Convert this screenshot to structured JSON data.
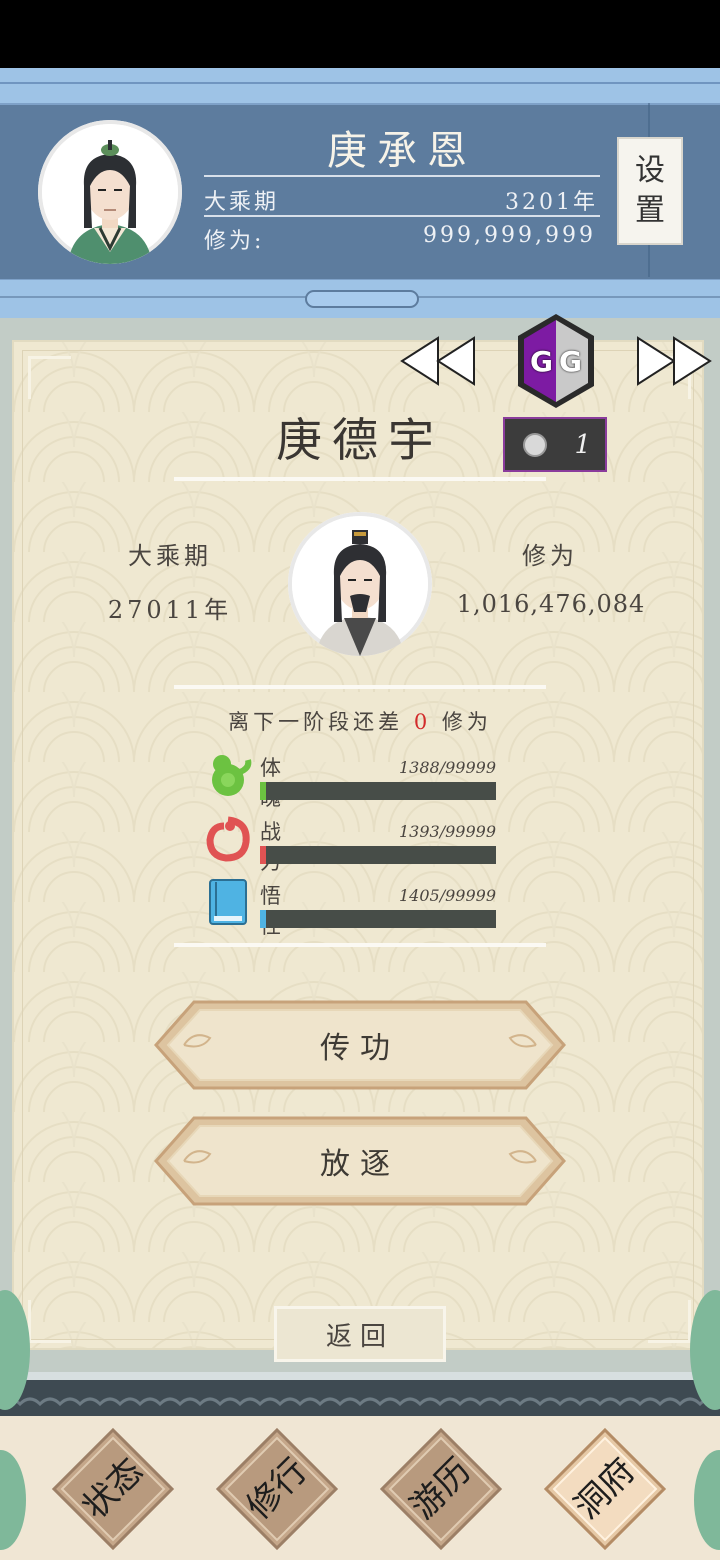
{
  "player": {
    "name": "庚承恩",
    "realm": "大乘期",
    "age": "3201年",
    "cultivation_label": "修为:",
    "cultivation_value": "999,999,999"
  },
  "settings_label": "设\n置",
  "settings_top": "设",
  "settings_bottom": "置",
  "gg_text": "GG",
  "disciple": {
    "name": "庚德宇",
    "count": "1",
    "realm": "大乘期",
    "age": "27011年",
    "cultivation_label": "修为",
    "cultivation_value": "1,016,476,084",
    "next_stage_prefix": "离下一阶段还差",
    "next_stage_value": "0",
    "next_stage_suffix": "修为"
  },
  "attributes": [
    {
      "label": "体魄",
      "value": "1388/99999",
      "fill": 0.0139,
      "color": "#6cc241",
      "icon": "green-gourd-icon"
    },
    {
      "label": "战力",
      "value": "1393/99999",
      "fill": 0.0139,
      "color": "#e05353",
      "icon": "red-dragon-icon"
    },
    {
      "label": "悟性",
      "value": "1405/99999",
      "fill": 0.0141,
      "color": "#4fb3e3",
      "icon": "blue-book-icon"
    }
  ],
  "buttons": {
    "transfer": "传功",
    "exile": "放逐",
    "back": "返回"
  },
  "nav": [
    {
      "line1": "状",
      "line2": "态"
    },
    {
      "line1": "修",
      "line2": "行"
    },
    {
      "line1": "游",
      "line2": "历"
    },
    {
      "line1": "洞",
      "line2": "府"
    }
  ]
}
